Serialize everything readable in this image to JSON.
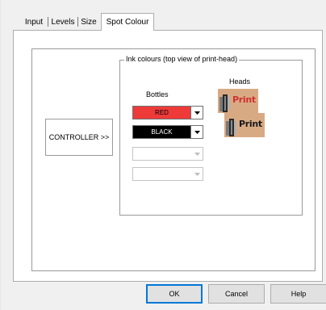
{
  "tabs": [
    {
      "label": "Input"
    },
    {
      "label": "Levels"
    },
    {
      "label": "Size"
    },
    {
      "label": "Spot Colour",
      "active": true
    }
  ],
  "controller_button": {
    "label": "CONTROLLER >>"
  },
  "ink_group": {
    "title": "Ink colours (top view of print-head)",
    "bottles_label": "Bottles",
    "heads_label": "Heads",
    "bottles": [
      {
        "value": "RED",
        "color": "#ef3a3a",
        "text_color": "#000000",
        "enabled": true
      },
      {
        "value": "BLACK",
        "color": "#000000",
        "text_color": "#ffffff",
        "enabled": true
      },
      {
        "value": "",
        "color": "#ffffff",
        "text_color": "#000000",
        "enabled": false
      },
      {
        "value": "",
        "color": "#ffffff",
        "text_color": "#000000",
        "enabled": false
      }
    ],
    "heads": [
      {
        "text": "Print",
        "text_color": "#d13030",
        "icon": "print-head-icon"
      },
      {
        "text": "Print",
        "text_color": "#1a1a1a",
        "icon": "print-head-icon"
      }
    ]
  },
  "footer": {
    "ok_label": "OK",
    "cancel_label": "Cancel",
    "help_label": "Help"
  }
}
